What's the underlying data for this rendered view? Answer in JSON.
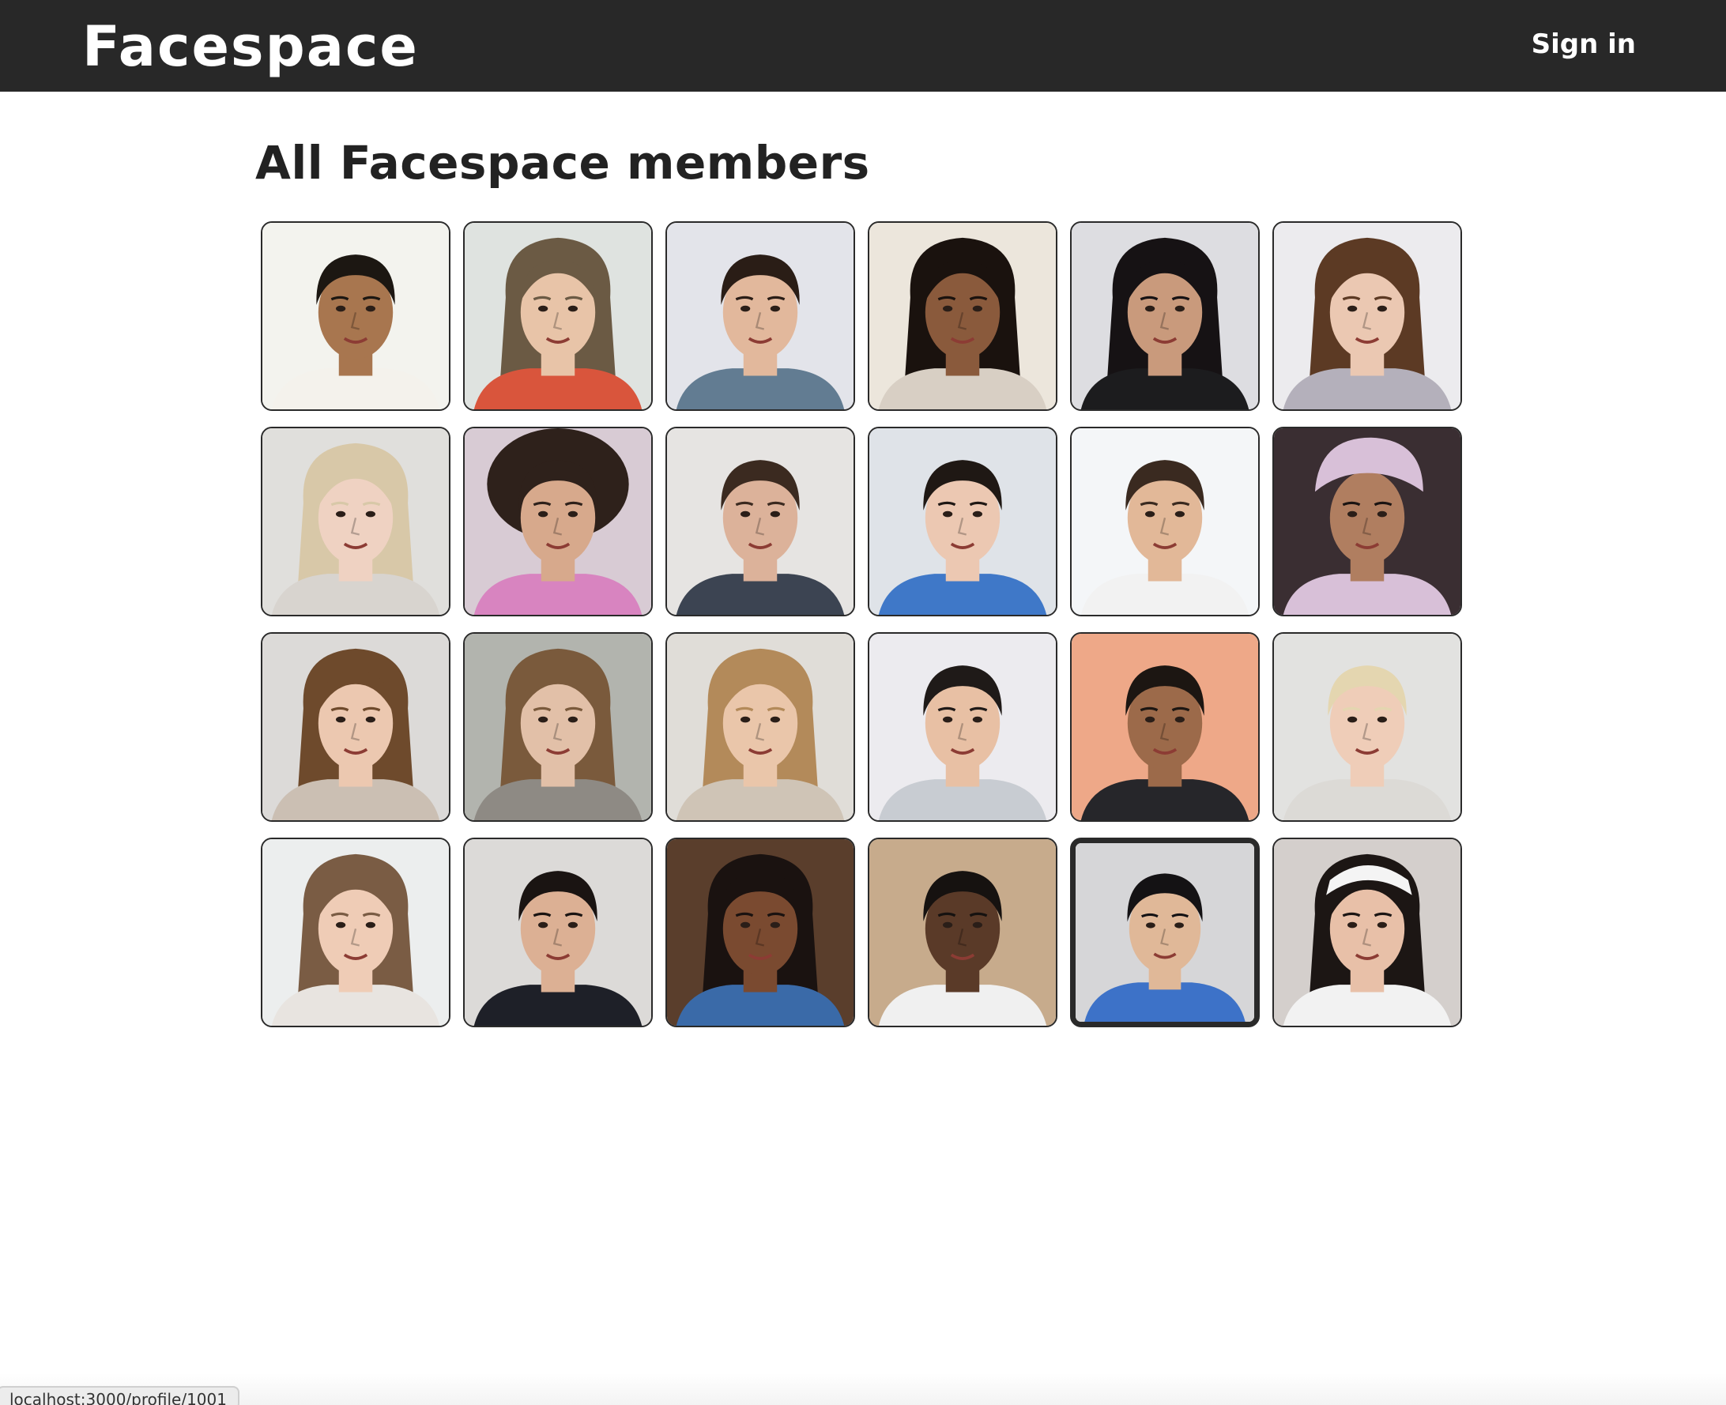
{
  "header": {
    "logo": "Facespace",
    "signin_label": "Sign in"
  },
  "page": {
    "title": "All Facespace members"
  },
  "members": [
    {
      "bg": "#f3f3ee",
      "skin": "#a8764f",
      "hair": "#1c1712",
      "shirt": "#f4f2ec",
      "style": "short"
    },
    {
      "bg": "#dfe3e0",
      "skin": "#e8c4a8",
      "hair": "#6b5a44",
      "shirt": "#d9553c",
      "style": "long"
    },
    {
      "bg": "#e3e4ea",
      "skin": "#e2b89c",
      "hair": "#2a1d16",
      "shirt": "#627c92",
      "style": "short"
    },
    {
      "bg": "#ece6dc",
      "skin": "#8a5a3c",
      "hair": "#1a120e",
      "shirt": "#d8cfc4",
      "style": "long"
    },
    {
      "bg": "#dddde1",
      "skin": "#c99a7c",
      "hair": "#161214",
      "shirt": "#1c1c1e",
      "style": "long"
    },
    {
      "bg": "#ecebee",
      "skin": "#ebc8b2",
      "hair": "#5c3a24",
      "shirt": "#b4b0bb",
      "style": "long"
    },
    {
      "bg": "#e0dfdc",
      "skin": "#efd2c2",
      "hair": "#d8c8a8",
      "shirt": "#d8d4cf",
      "style": "long"
    },
    {
      "bg": "#d8cbd4",
      "skin": "#d7a98c",
      "hair": "#2e211b",
      "shirt": "#d884c0",
      "style": "curly"
    },
    {
      "bg": "#e6e4e2",
      "skin": "#dcb29a",
      "hair": "#3b2a20",
      "shirt": "#3c4452",
      "style": "short"
    },
    {
      "bg": "#dfe3e8",
      "skin": "#ecc8b2",
      "hair": "#1f1814",
      "shirt": "#3f78c8",
      "style": "short"
    },
    {
      "bg": "#f4f6f8",
      "skin": "#e2b898",
      "hair": "#3a2a20",
      "shirt": "#f2f2f2",
      "style": "short"
    },
    {
      "bg": "#3a2e32",
      "skin": "#b07e60",
      "hair": "#1a1412",
      "shirt": "#d8c0d8",
      "style": "cap"
    },
    {
      "bg": "#dcdad8",
      "skin": "#ecc8b0",
      "hair": "#6e4a2c",
      "shirt": "#cbbfb3",
      "style": "long"
    },
    {
      "bg": "#b2b4ae",
      "skin": "#e2c0a8",
      "hair": "#7a5a3c",
      "shirt": "#8e8a84",
      "style": "long"
    },
    {
      "bg": "#e0ddd8",
      "skin": "#eac6aa",
      "hair": "#b38a5a",
      "shirt": "#cfc4b6",
      "style": "long"
    },
    {
      "bg": "#ecebef",
      "skin": "#e8c0a4",
      "hair": "#1f1a18",
      "shirt": "#c8ccd2",
      "style": "short"
    },
    {
      "bg": "#eea888",
      "skin": "#9c6a4a",
      "hair": "#1c1612",
      "shirt": "#26262a",
      "style": "short"
    },
    {
      "bg": "#e2e2e0",
      "skin": "#efcdb8",
      "hair": "#e4d6b0",
      "shirt": "#dcdad6",
      "style": "short"
    },
    {
      "bg": "#eceeee",
      "skin": "#efccb6",
      "hair": "#7a5c44",
      "shirt": "#e8e4e0",
      "style": "long"
    },
    {
      "bg": "#dcdad8",
      "skin": "#dcb094",
      "hair": "#1a1412",
      "shirt": "#1e2028",
      "style": "short"
    },
    {
      "bg": "#5a3e2c",
      "skin": "#7a4a30",
      "hair": "#1a1210",
      "shirt": "#3a6aa8",
      "style": "bun"
    },
    {
      "bg": "#c7ab8c",
      "skin": "#5a3a28",
      "hair": "#161210",
      "shirt": "#f0f0f0",
      "style": "short"
    },
    {
      "bg": "#d6d6d8",
      "skin": "#e0b898",
      "hair": "#141214",
      "shirt": "#3d72c8",
      "style": "short"
    },
    {
      "bg": "#d4cfcc",
      "skin": "#e8c0a8",
      "hair": "#1c1614",
      "shirt": "#f2f2f2",
      "style": "band"
    }
  ],
  "active_member_index": 22,
  "status_bar": {
    "url": "localhost:3000/profile/1001"
  }
}
